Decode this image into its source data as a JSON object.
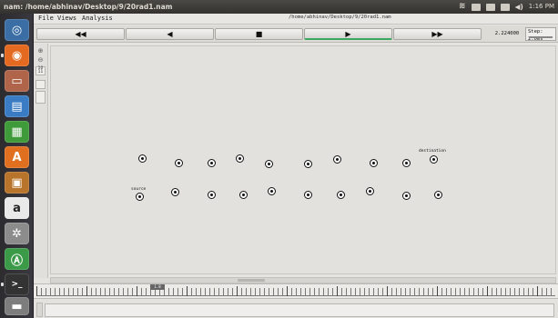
{
  "top_panel": {
    "title": "nam: /home/abhinav/Desktop/9/20rad1.nam",
    "clock": "1:16 PM",
    "indicators": [
      "wifi-icon",
      "keyboard-icon",
      "mail-icon",
      "battery-icon",
      "volume-icon"
    ]
  },
  "launcher": {
    "items": [
      {
        "name": "dash-home",
        "glyph": "◎",
        "color": "#3a6ea5"
      },
      {
        "name": "firefox",
        "glyph": "◉",
        "color": "#e36a20"
      },
      {
        "name": "files",
        "glyph": "▭",
        "color": "#b0654a"
      },
      {
        "name": "writer",
        "glyph": "▤",
        "color": "#3a7cc4"
      },
      {
        "name": "calc",
        "glyph": "▦",
        "color": "#3f9a3a"
      },
      {
        "name": "impress",
        "glyph": "▥",
        "color": "#c0501e"
      },
      {
        "name": "software-center",
        "glyph": "A",
        "color": "#e08a30"
      },
      {
        "name": "ebook",
        "glyph": "▣",
        "color": "#b8742a"
      },
      {
        "name": "amazon",
        "glyph": "a",
        "color": "#e9e9e9"
      },
      {
        "name": "settings",
        "glyph": "✲",
        "color": "#8c8c8c"
      },
      {
        "name": "update",
        "glyph": "Ⓐ",
        "color": "#3a9a48"
      },
      {
        "name": "terminal",
        "glyph": ">_",
        "color": "#333333"
      },
      {
        "name": "disk",
        "glyph": "▬",
        "color": "#7d7d7d"
      },
      {
        "name": "trash",
        "glyph": "♻",
        "color": "#6e6e6e"
      }
    ]
  },
  "menubar": {
    "file": "File",
    "views": "Views",
    "analysis": "Analysis",
    "path": "/home/abhinav/Desktop/9/20rad1.nam"
  },
  "controls": {
    "rewind": "◀◀",
    "back": "◀",
    "stop": "■",
    "play": "▶",
    "fast_forward": "▶▶",
    "time": "2.224000",
    "step": "Step: 2.0ms"
  },
  "tools": {
    "zoom_in": "⊕",
    "zoom_out": "⊖",
    "tool3": "10",
    "tool4": "11"
  },
  "node_labels": {
    "source": "source",
    "destination": "destination"
  },
  "timeline": {
    "marker": "1.8"
  }
}
